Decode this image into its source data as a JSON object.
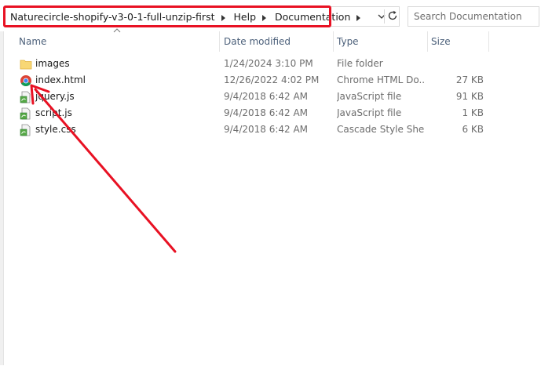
{
  "breadcrumb": {
    "items": [
      "Naturecircle-shopify-v3-0-1-full-unzip-first",
      "Help",
      "Documentation"
    ]
  },
  "search": {
    "placeholder": "Search Documentation"
  },
  "columns": {
    "name": "Name",
    "date_modified": "Date modified",
    "type": "Type",
    "size": "Size"
  },
  "files": [
    {
      "name": "images",
      "date": "1/24/2024 3:10 PM",
      "type": "File folder",
      "size": "",
      "icon": "folder-icon"
    },
    {
      "name": "index.html",
      "date": "12/26/2022 4:02 PM",
      "type": "Chrome HTML Do...",
      "size": "27 KB",
      "icon": "chrome-icon"
    },
    {
      "name": "jquery.js",
      "date": "9/4/2018 6:42 AM",
      "type": "JavaScript file",
      "size": "91 KB",
      "icon": "script-file-icon"
    },
    {
      "name": "script.js",
      "date": "9/4/2018 6:42 AM",
      "type": "JavaScript file",
      "size": "1 KB",
      "icon": "script-file-icon"
    },
    {
      "name": "style.css",
      "date": "9/4/2018 6:42 AM",
      "type": "Cascade Style She...",
      "size": "6 KB",
      "icon": "script-file-icon"
    }
  ],
  "colors": {
    "highlight": "#e81123",
    "header_text": "#4c607a",
    "folder": "#f8d775"
  }
}
